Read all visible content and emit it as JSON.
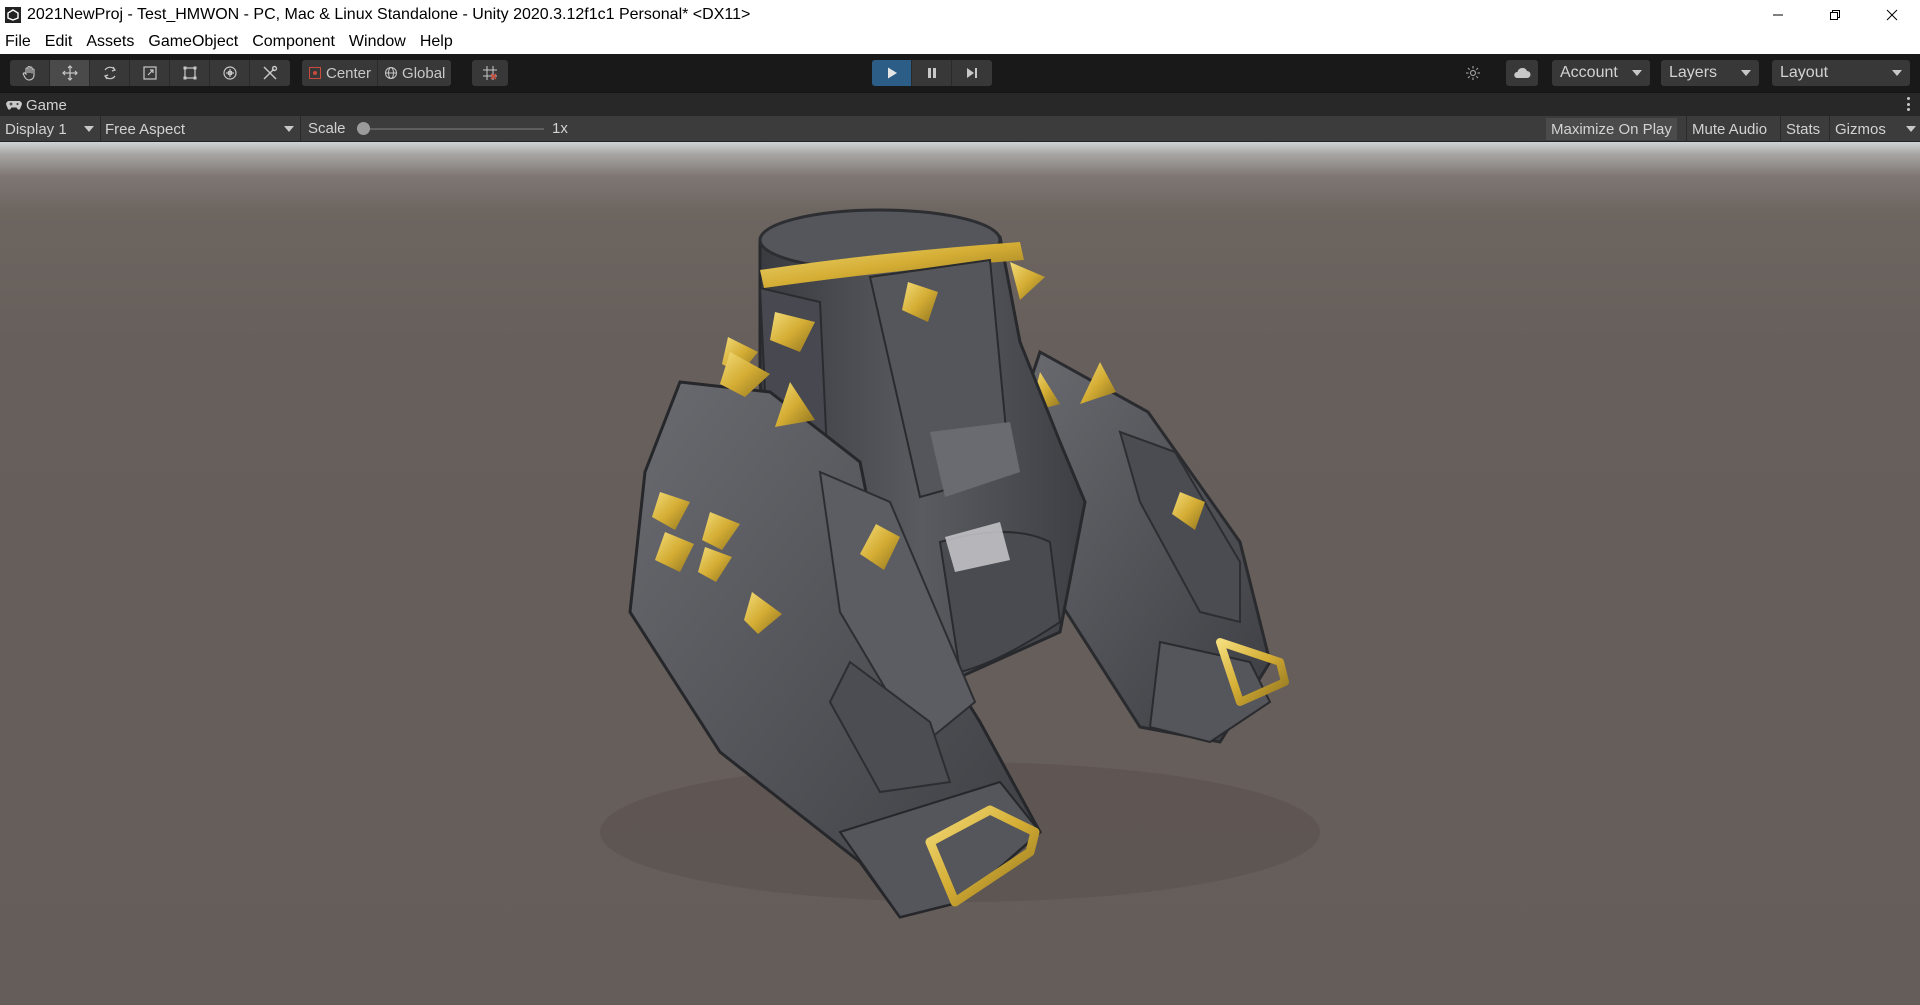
{
  "window": {
    "title": "2021NewProj - Test_HMWON - PC, Mac & Linux Standalone - Unity 2020.3.12f1c1 Personal* <DX11>",
    "controls": [
      "minimize-icon",
      "restore-icon",
      "close-icon"
    ]
  },
  "menu": {
    "items": [
      "File",
      "Edit",
      "Assets",
      "GameObject",
      "Component",
      "Window",
      "Help"
    ]
  },
  "toolbar": {
    "tools": [
      "hand-tool-icon",
      "move-tool-icon",
      "rotate-tool-icon",
      "scale-tool-icon",
      "rect-tool-icon",
      "transform-tool-icon",
      "custom-tool-icon"
    ],
    "active_tool": "move-tool-icon",
    "pivot_mode": "Center",
    "pivot_rotation": "Global",
    "grid_snap_icon": "grid-snap-icon",
    "play_controls": [
      "play-icon",
      "pause-icon",
      "step-icon"
    ],
    "playing": true,
    "account_label": "Account",
    "layers_label": "Layers",
    "layout_label": "Layout",
    "accent_color": "#2c5d87"
  },
  "game_tab": {
    "label": "Game",
    "icon": "gamepad-icon"
  },
  "game_controls": {
    "display": "Display 1",
    "aspect": "Free Aspect",
    "scale_label": "Scale",
    "scale_value": "1x",
    "scale_fraction": 0.0,
    "maximize_on_play": "Maximize On Play",
    "maximize_on_play_enabled": true,
    "mute_audio": "Mute Audio",
    "stats": "Stats",
    "gizmos": "Gizmos"
  },
  "viewport": {
    "subject": "3D dark metal tower base with gold spikes and gold handles",
    "ground_color": "#675f5b",
    "metal_color": "#4f5055",
    "gold_color": "#d9b53a"
  }
}
